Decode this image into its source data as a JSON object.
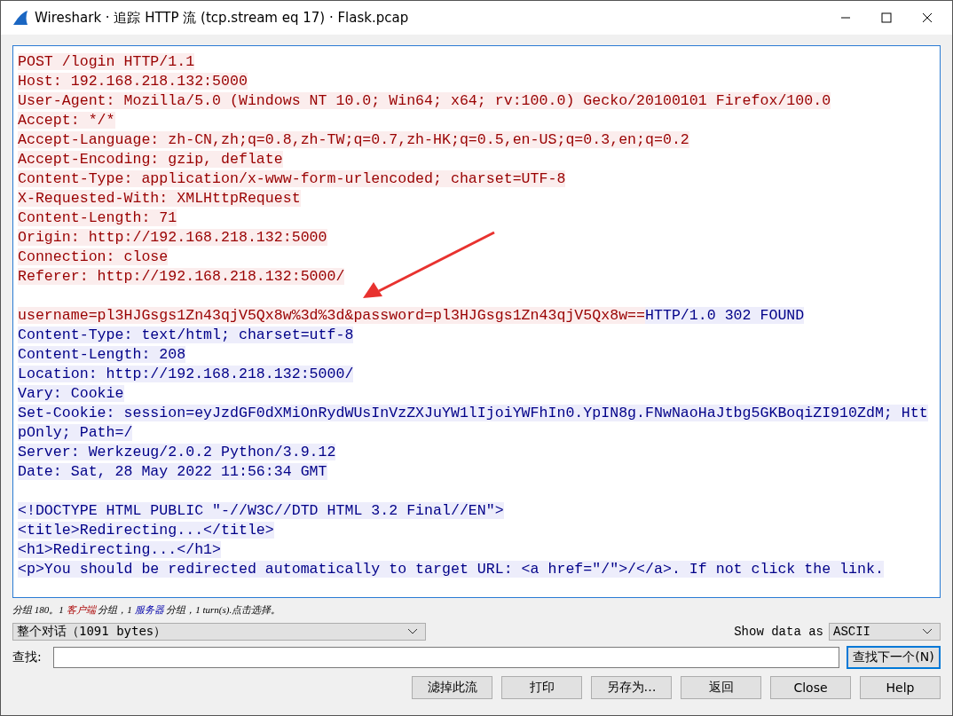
{
  "window": {
    "title": "Wireshark · 追踪 HTTP 流 (tcp.stream eq 17) · Flask.pcap"
  },
  "stream": {
    "blocks": [
      {
        "lines": [
          {
            "segments": [
              {
                "kind": "client",
                "text": "POST /login HTTP/1.1"
              }
            ]
          },
          {
            "segments": [
              {
                "kind": "client",
                "text": "Host: 192.168.218.132:5000"
              }
            ]
          },
          {
            "segments": [
              {
                "kind": "client",
                "text": "User-Agent: Mozilla/5.0 (Windows NT 10.0; Win64; x64; rv:100.0) Gecko/20100101 Firefox/100.0"
              }
            ]
          },
          {
            "segments": [
              {
                "kind": "client",
                "text": "Accept: */*"
              }
            ]
          },
          {
            "segments": [
              {
                "kind": "client",
                "text": "Accept-Language: zh-CN,zh;q=0.8,zh-TW;q=0.7,zh-HK;q=0.5,en-US;q=0.3,en;q=0.2"
              }
            ]
          },
          {
            "segments": [
              {
                "kind": "client",
                "text": "Accept-Encoding: gzip, deflate"
              }
            ]
          },
          {
            "segments": [
              {
                "kind": "client",
                "text": "Content-Type: application/x-www-form-urlencoded; charset=UTF-8"
              }
            ]
          },
          {
            "segments": [
              {
                "kind": "client",
                "text": "X-Requested-With: XMLHttpRequest"
              }
            ]
          },
          {
            "segments": [
              {
                "kind": "client",
                "text": "Content-Length: 71"
              }
            ]
          },
          {
            "segments": [
              {
                "kind": "client",
                "text": "Origin: http://192.168.218.132:5000"
              }
            ]
          },
          {
            "segments": [
              {
                "kind": "client",
                "text": "Connection: close"
              }
            ]
          },
          {
            "segments": [
              {
                "kind": "client",
                "text": "Referer: http://192.168.218.132:5000/"
              }
            ]
          }
        ]
      },
      {
        "lines": [
          {
            "segments": [
              {
                "kind": "client",
                "text": "username=pl3HJGsgs1Zn43qjV5Qx8w%3d%3d&password=pl3HJGsgs1Zn43qjV5Qx8w=="
              },
              {
                "kind": "server",
                "text": "HTTP/1.0 302 FOUND"
              }
            ]
          },
          {
            "segments": [
              {
                "kind": "server",
                "text": "Content-Type: text/html; charset=utf-8"
              }
            ]
          },
          {
            "segments": [
              {
                "kind": "server",
                "text": "Content-Length: 208"
              }
            ]
          },
          {
            "segments": [
              {
                "kind": "server",
                "text": "Location: http://192.168.218.132:5000/"
              }
            ]
          },
          {
            "segments": [
              {
                "kind": "server",
                "text": "Vary: Cookie"
              }
            ]
          },
          {
            "segments": [
              {
                "kind": "server",
                "text": "Set-Cookie: session=eyJzdGF0dXMiOnRydWUsInVzZXJuYW1lIjoiYWFhIn0.YpIN8g.FNwNaoHaJtbg5GKBoqiZI910ZdM; Htt"
              }
            ]
          },
          {
            "segments": [
              {
                "kind": "server",
                "text": "pOnly; Path=/"
              }
            ]
          },
          {
            "segments": [
              {
                "kind": "server",
                "text": "Server: Werkzeug/2.0.2 Python/3.9.12"
              }
            ]
          },
          {
            "segments": [
              {
                "kind": "server",
                "text": "Date: Sat, 28 May 2022 11:56:34 GMT"
              }
            ]
          }
        ]
      },
      {
        "lines": [
          {
            "segments": [
              {
                "kind": "server",
                "text": "<!DOCTYPE HTML PUBLIC \"-//W3C//DTD HTML 3.2 Final//EN\">"
              }
            ]
          },
          {
            "segments": [
              {
                "kind": "server",
                "text": "<title>Redirecting...</title>"
              }
            ]
          },
          {
            "segments": [
              {
                "kind": "server",
                "text": "<h1>Redirecting...</h1>"
              }
            ]
          },
          {
            "segments": [
              {
                "kind": "server",
                "text": "<p>You should be redirected automatically to target URL: <a href=\"/\">/</a>. If not click the link."
              }
            ]
          }
        ]
      }
    ]
  },
  "status": [
    {
      "kind": "plain",
      "text": "分组 180。1 "
    },
    {
      "kind": "client",
      "text": "客户端"
    },
    {
      "kind": "plain",
      "text": " 分组，1 "
    },
    {
      "kind": "server",
      "text": "服务器"
    },
    {
      "kind": "plain",
      "text": " 分组，1 turn(s).点击选择。"
    }
  ],
  "conversation_select": {
    "value": "整个对话（1091 bytes）"
  },
  "show_data": {
    "label": "Show data as",
    "value": "ASCII"
  },
  "find": {
    "label": "查找:",
    "button": "查找下一个(N)"
  },
  "buttons": [
    "滤掉此流",
    "打印",
    "另存为…",
    "返回",
    "Close",
    "Help"
  ]
}
